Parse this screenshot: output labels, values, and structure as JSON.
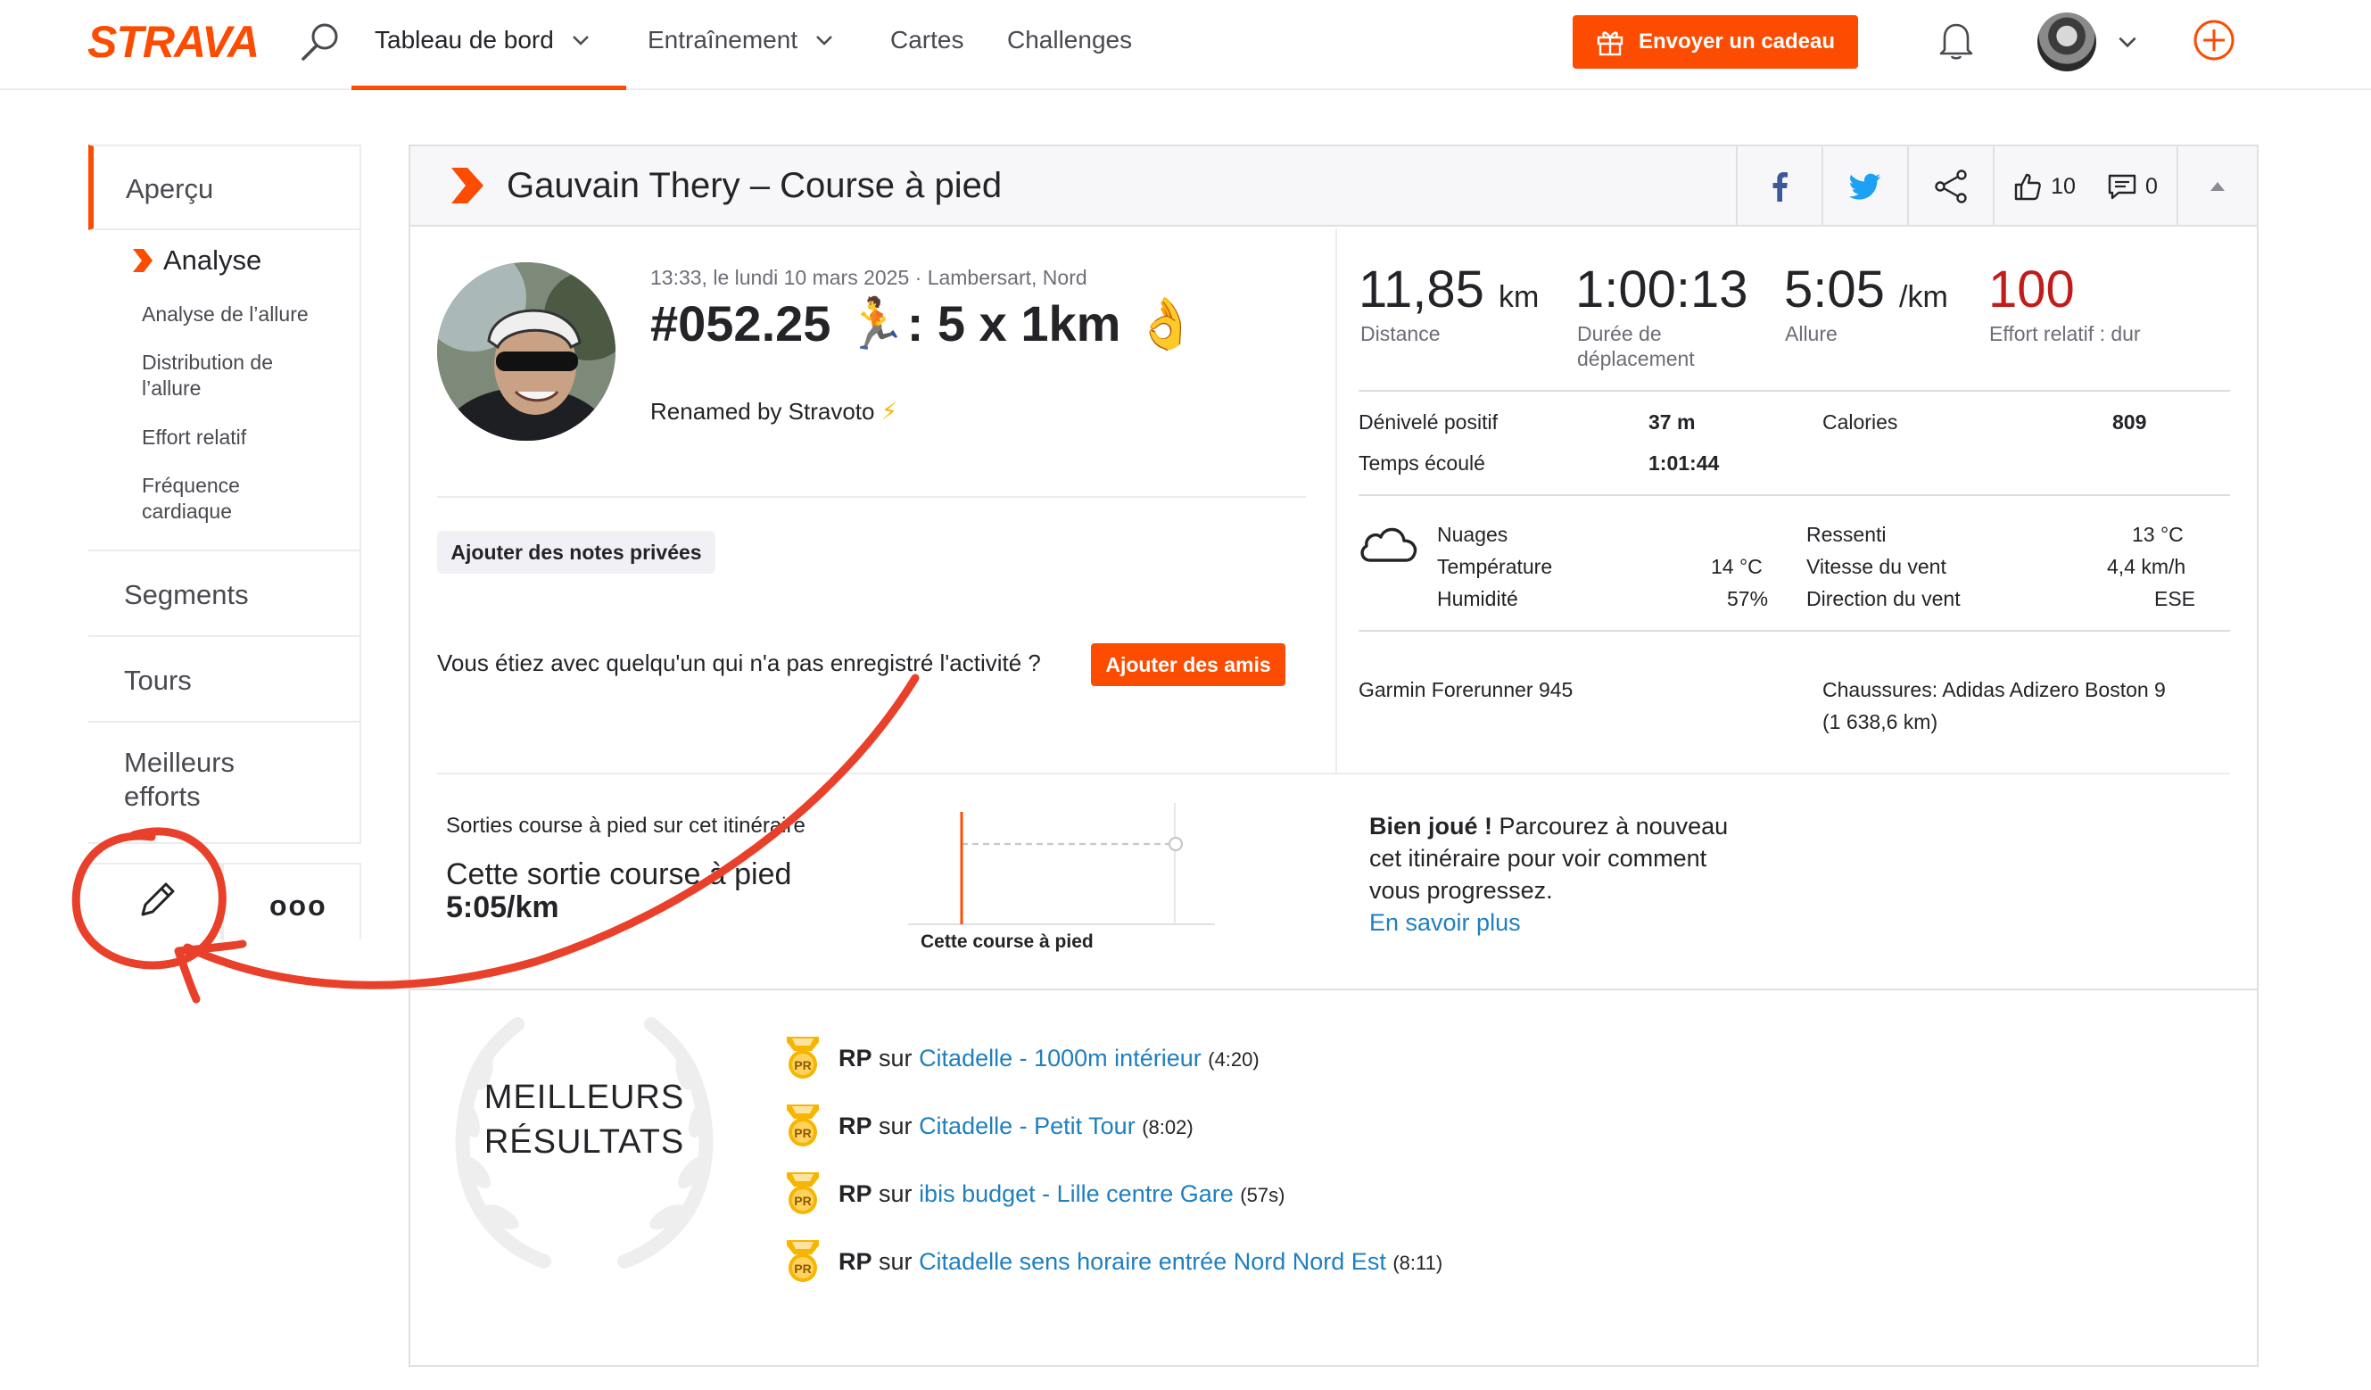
{
  "nav": {
    "logo": "STRAVA",
    "dashboard": "Tableau de bord",
    "training": "Entraînement",
    "maps": "Cartes",
    "challenges": "Challenges",
    "gift": "Envoyer un cadeau"
  },
  "sidebar": {
    "overview": "Aperçu",
    "analysis": "Analyse",
    "analysis_items": [
      "Analyse de l’allure",
      "Distribution de l’allure",
      "Effort relatif",
      "Fréquence cardiaque"
    ],
    "segments": "Segments",
    "laps": "Tours",
    "best_efforts": "Meilleurs efforts",
    "more": "ooo"
  },
  "activity": {
    "title": "Gauvain Thery – Course à pied",
    "kudos": "10",
    "comments": "0",
    "meta": "13:33, le lundi 10 mars 2025 · Lambersart, Nord",
    "name": "#052.25 🏃: 5 x 1km 👌",
    "description": "Renamed by Stravoto",
    "bolt": "⚡",
    "notes_button": "Ajouter des notes privées",
    "with_text": "Vous étiez avec quelqu'un qui n'a pas enregistré l'activité ?",
    "add_friends": "Ajouter des amis"
  },
  "stats": {
    "distance": {
      "value": "11,85",
      "unit": "km",
      "label": "Distance"
    },
    "moving_time": {
      "value": "1:00:13",
      "label": "Durée de déplacement"
    },
    "pace": {
      "value": "5:05",
      "unit": "/km",
      "label": "Allure"
    },
    "effort": {
      "value": "100",
      "label": "Effort relatif : dur"
    },
    "elevation_label": "Dénivelé positif",
    "elevation_value": "37 m",
    "calories_label": "Calories",
    "calories_value": "809",
    "elapsed_label": "Temps écoulé",
    "elapsed_value": "1:01:44"
  },
  "weather": {
    "condition": "Nuages",
    "temp_label": "Température",
    "temp_value": "14 °C",
    "humidity_label": "Humidité",
    "humidity_value": "57%",
    "feels_label": "Ressenti",
    "feels_value": "13 °C",
    "wind_label": "Vitesse du vent",
    "wind_value": "4,4 km/h",
    "dir_label": "Direction du vent",
    "dir_value": "ESE"
  },
  "gear": {
    "device": "Garmin Forerunner 945",
    "shoes": "Chaussures: Adidas Adizero Boston 9",
    "shoes_km": "(1 638,6 km)"
  },
  "route": {
    "title": "Sorties course à pied sur cet itinéraire",
    "subtitle": "Cette sortie course à pied",
    "pace": "5:05/km",
    "chart_label": "Cette course à pied",
    "msg_bold": "Bien joué !",
    "msg": " Parcourez à nouveau cet itinéraire pour voir comment vous progressez.",
    "learn_more": "En savoir plus"
  },
  "best": {
    "title_line1": "MEILLEURS",
    "title_line2": "RÉSULTATS",
    "badge": "PR",
    "items": [
      {
        "prefix": "RP",
        "on": "sur",
        "segment": "Citadelle - 1000m intérieur",
        "time": "(4:20)"
      },
      {
        "prefix": "RP",
        "on": "sur",
        "segment": "Citadelle - Petit Tour",
        "time": "(8:02)"
      },
      {
        "prefix": "RP",
        "on": "sur",
        "segment": "ibis budget - Lille centre Gare",
        "time": "(57s)"
      },
      {
        "prefix": "RP",
        "on": "sur",
        "segment": "Citadelle sens horaire entrée Nord Nord Est",
        "time": "(8:11)"
      }
    ]
  },
  "colors": {
    "brand": "#fc4c02",
    "link": "#1f7fbf",
    "effort": "#c11c1c",
    "annotation": "#e8402a"
  }
}
